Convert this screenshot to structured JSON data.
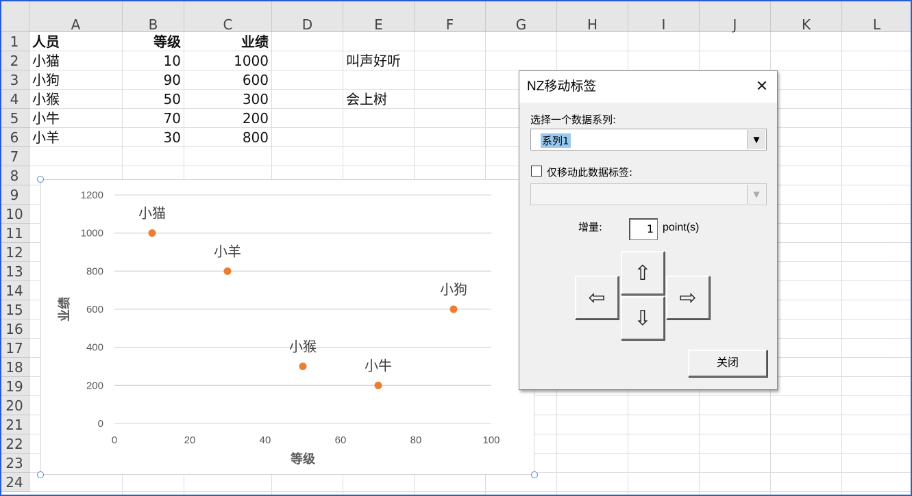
{
  "columns": [
    "A",
    "B",
    "C",
    "D",
    "E",
    "F",
    "G",
    "H",
    "I",
    "J",
    "K",
    "L"
  ],
  "rows": [
    "1",
    "2",
    "3",
    "4",
    "5",
    "6",
    "7",
    "8",
    "9",
    "10",
    "11",
    "12",
    "13",
    "14",
    "15",
    "16",
    "17",
    "18",
    "19",
    "20",
    "21",
    "22",
    "23",
    "24"
  ],
  "table": {
    "headers": [
      "人员",
      "等级",
      "业绩"
    ],
    "data": [
      [
        "小猫",
        "10",
        "1000"
      ],
      [
        "小狗",
        "90",
        "600"
      ],
      [
        "小猴",
        "50",
        "300"
      ],
      [
        "小牛",
        "70",
        "200"
      ],
      [
        "小羊",
        "30",
        "800"
      ]
    ]
  },
  "notes": {
    "e2": "叫声好听",
    "e4": "会上树"
  },
  "chart_data": {
    "type": "scatter",
    "xlabel": "等级",
    "ylabel": "业绩",
    "xlim": [
      0,
      100
    ],
    "ylim": [
      0,
      1200
    ],
    "x_ticks": [
      "0",
      "20",
      "40",
      "60",
      "80",
      "100"
    ],
    "y_ticks": [
      "0",
      "200",
      "400",
      "600",
      "800",
      "1000",
      "1200"
    ],
    "grid": "horizontal",
    "marker_color": "#ED7D31",
    "points": [
      {
        "label": "小猫",
        "x": 10,
        "y": 1000
      },
      {
        "label": "小羊",
        "x": 30,
        "y": 800
      },
      {
        "label": "小狗",
        "x": 90,
        "y": 600
      },
      {
        "label": "小猴",
        "x": 50,
        "y": 300
      },
      {
        "label": "小牛",
        "x": 70,
        "y": 200
      }
    ]
  },
  "dialog": {
    "title": "NZ移动标签",
    "close_glyph": "✕",
    "series_label": "选择一个数据系列:",
    "series_value": "系列1",
    "only_this_label": "仅移动此数据标签:",
    "increment_label": "增量:",
    "increment_value": "1",
    "increment_unit": "point(s)",
    "close_button": "关闭"
  },
  "colors": {
    "accent": "#ED7D31",
    "selection": "#99C9EF",
    "border": "#2A5BD7"
  }
}
